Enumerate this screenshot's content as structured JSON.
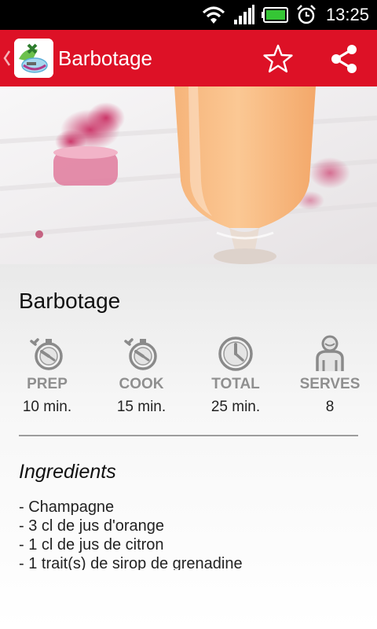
{
  "status_bar": {
    "time": "13:25"
  },
  "action_bar": {
    "title": "Barbotage"
  },
  "recipe": {
    "title": "Barbotage",
    "stats": [
      {
        "label": "PREP",
        "value": "10 min.",
        "icon": "stopwatch-icon"
      },
      {
        "label": "COOK",
        "value": "15 min.",
        "icon": "stopwatch-icon"
      },
      {
        "label": "TOTAL",
        "value": "25 min.",
        "icon": "clock-icon"
      },
      {
        "label": "SERVES",
        "value": "8",
        "icon": "person-icon"
      }
    ],
    "ingredients_title": "Ingredients",
    "ingredients": [
      "- Champagne",
      "- 3 cl de jus d'orange",
      "- 1 cl de jus de citron",
      "- 1 trait(s) de sirop de grenadine"
    ]
  },
  "colors": {
    "accent": "#dd1126",
    "stat_label": "#8f8f8f",
    "stat_icon": "#8a8a8a"
  }
}
